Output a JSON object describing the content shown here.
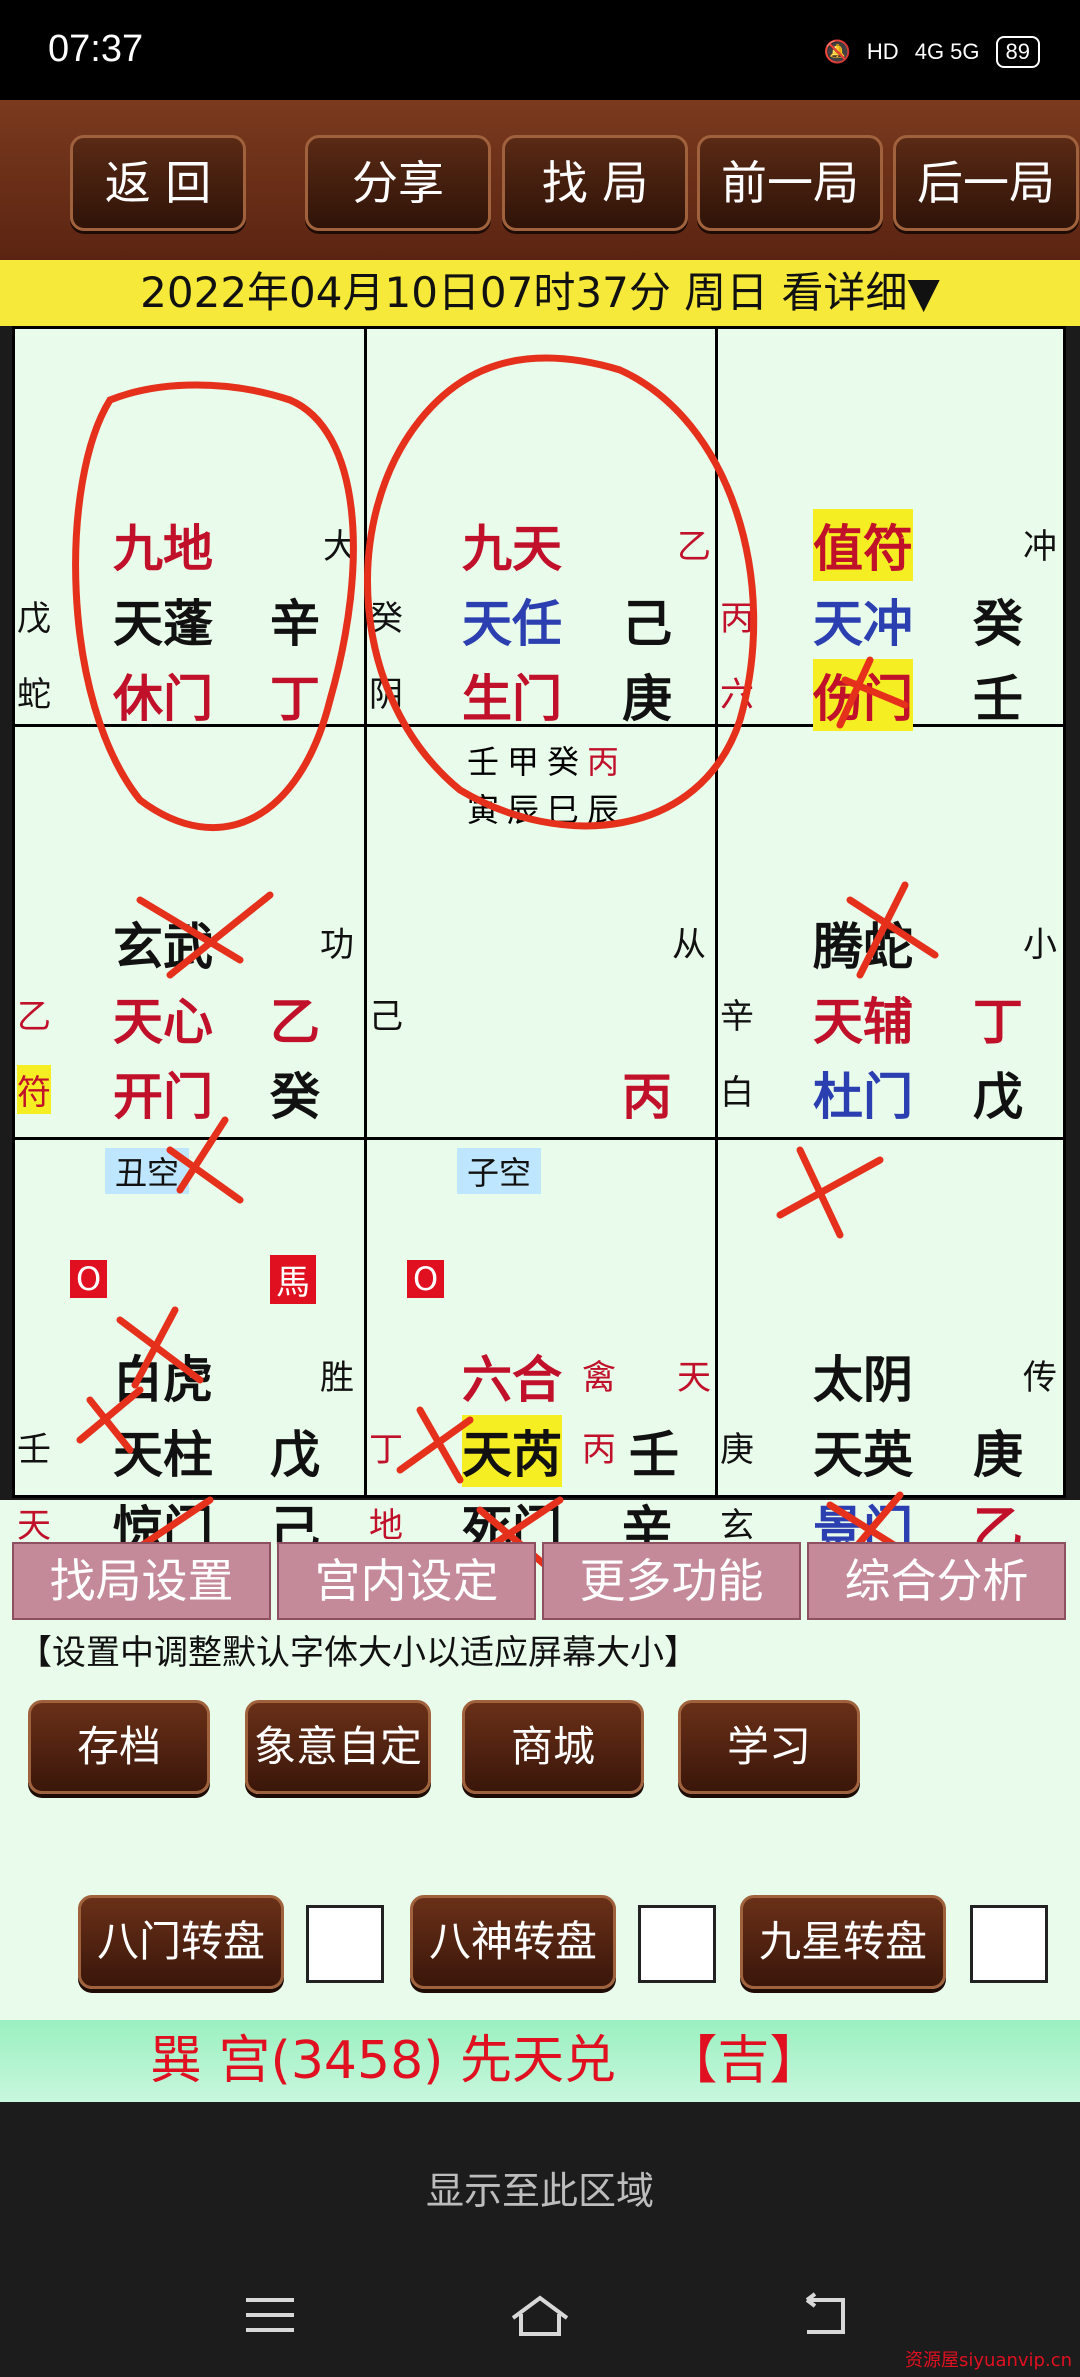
{
  "status": {
    "time": "07:37",
    "network": "4G 5G",
    "hd": "HD",
    "battery": "89"
  },
  "toolbar": {
    "back": "返 回",
    "share": "分享",
    "find": "找 局",
    "prev": "前一局",
    "next": "后一局"
  },
  "date_bar": "2022年04月10日07时37分 周日 看详细▼",
  "palaces": {
    "nw": {
      "god": "九地",
      "god_side": "大",
      "star_left": "戊",
      "star": "天蓬",
      "star_right": "辛",
      "door_left": "蛇",
      "door": "休门",
      "door_right": "丁"
    },
    "n": {
      "god": "九天",
      "god_side": "乙",
      "star_left": "癸",
      "star": "天任",
      "star_right": "己",
      "door_left": "阴",
      "door": "生门",
      "door_right": "庚"
    },
    "ne": {
      "god": "值符",
      "god_side": "冲",
      "star_left": "丙",
      "star": "天冲",
      "star_right": "癸",
      "door_left": "六",
      "door": "伤门",
      "door_right": "壬"
    },
    "w": {
      "god": "玄武",
      "god_side": "功",
      "star_left": "乙",
      "star": "天心",
      "star_right": "乙",
      "door_left": "符",
      "door": "开门",
      "door_right": "癸"
    },
    "c": {
      "pillars_top": [
        "壬",
        "甲",
        "癸",
        "丙"
      ],
      "pillars_bottom": [
        "寅",
        "辰",
        "巳",
        "辰"
      ],
      "side": "从",
      "left": "己",
      "bottom_right": "丙"
    },
    "e": {
      "god": "腾蛇",
      "god_side": "小",
      "star_left": "辛",
      "star": "天辅",
      "star_right": "丁",
      "door_left": "白",
      "door": "杜门",
      "door_right": "戊"
    },
    "sw": {
      "empty": "丑空",
      "mark": "O",
      "horse": "馬",
      "god": "白虎",
      "god_side": "胜",
      "star_left": "壬",
      "star": "天柱",
      "star_right": "戊",
      "door_left": "天",
      "door": "惊门",
      "door_right": "己"
    },
    "s": {
      "empty": "子空",
      "mark": "O",
      "god": "六合",
      "god_extra": "禽",
      "god_side": "天",
      "star_left": "丁",
      "star": "天芮",
      "star_mid": "丙",
      "star_right": "壬",
      "door_left": "地",
      "door": "死门",
      "door_right": "辛"
    },
    "se": {
      "god": "太阴",
      "god_side": "传",
      "star_left": "庚",
      "star": "天英",
      "star_right": "庚",
      "door_left": "玄",
      "door": "景门",
      "door_right": "乙"
    }
  },
  "menu": [
    "找局设置",
    "宫内设定",
    "更多功能",
    "综合分析"
  ],
  "hint": "【设置中调整默认字体大小以适应屏幕大小】",
  "actions": [
    "存档",
    "象意自定",
    "商城",
    "学习"
  ],
  "dials": [
    "八门转盘",
    "八神转盘",
    "九星转盘"
  ],
  "info": "巽 宫(3458) 先天兑   【吉】",
  "bottom_hint": "显示至此区域",
  "watermark": "资源屋siyuanvip.cn"
}
